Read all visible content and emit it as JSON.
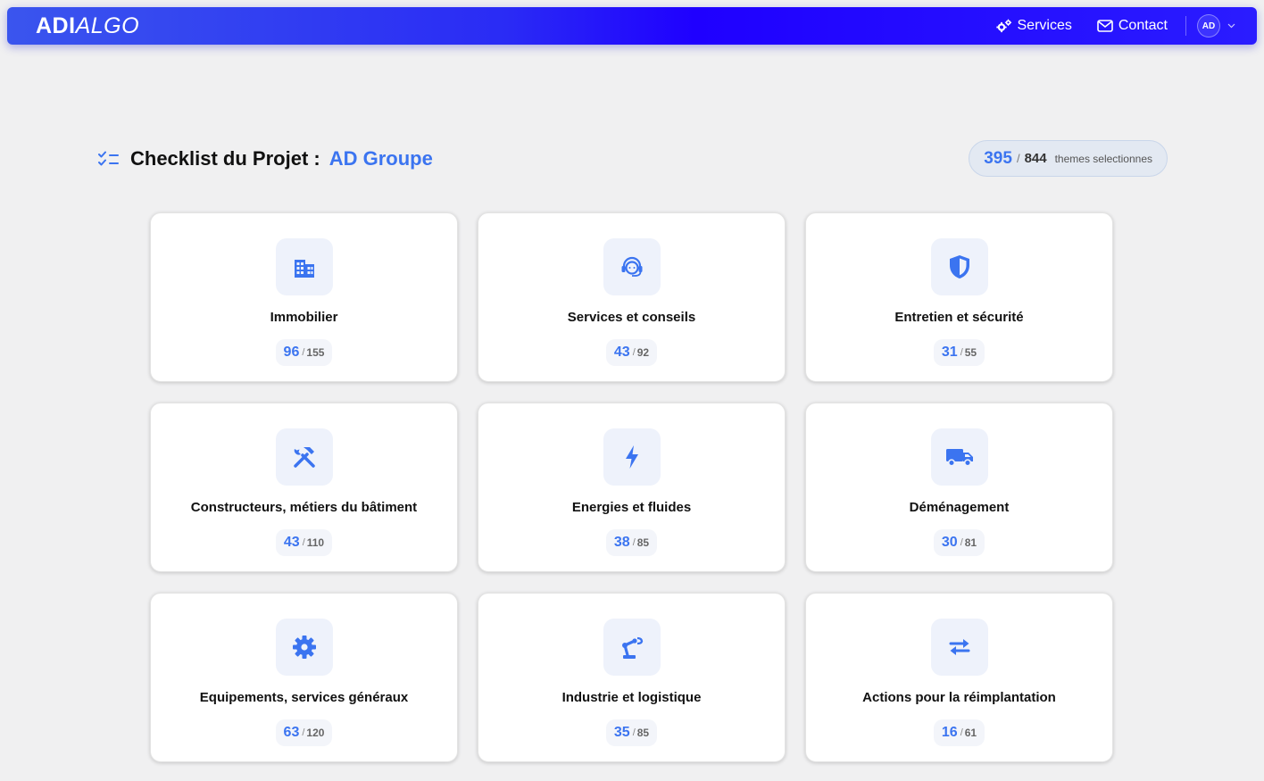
{
  "navbar": {
    "logo_bold": "ADI",
    "logo_light": "ALGO",
    "services_label": "Services",
    "contact_label": "Contact",
    "avatar_initials": "AD"
  },
  "header": {
    "title": "Checklist du Projet :",
    "project_name": "AD Groupe",
    "selected_total": "395",
    "total": "844",
    "counter_label": "themes selectionnes"
  },
  "categories": [
    {
      "label": "Immobilier",
      "selected": "96",
      "total": "155",
      "icon": "building-icon"
    },
    {
      "label": "Services et conseils",
      "selected": "43",
      "total": "92",
      "icon": "headset-icon"
    },
    {
      "label": "Entretien et sécurité",
      "selected": "31",
      "total": "55",
      "icon": "shield-icon"
    },
    {
      "label": "Constructeurs, métiers du bâtiment",
      "selected": "43",
      "total": "110",
      "icon": "tools-icon"
    },
    {
      "label": "Energies et fluides",
      "selected": "38",
      "total": "85",
      "icon": "bolt-icon"
    },
    {
      "label": "Déménagement",
      "selected": "30",
      "total": "81",
      "icon": "truck-icon"
    },
    {
      "label": "Equipements, services généraux",
      "selected": "63",
      "total": "120",
      "icon": "gear-icon"
    },
    {
      "label": "Industrie et logistique",
      "selected": "35",
      "total": "85",
      "icon": "robot-arm-icon"
    },
    {
      "label": "Actions pour la réimplantation",
      "selected": "16",
      "total": "61",
      "icon": "arrows-exchange-icon"
    }
  ],
  "colors": {
    "accent": "#3b74f0",
    "navbar_start": "#3a55ee",
    "navbar_end": "#1f00ff",
    "page_bg": "#f0f0f1"
  }
}
